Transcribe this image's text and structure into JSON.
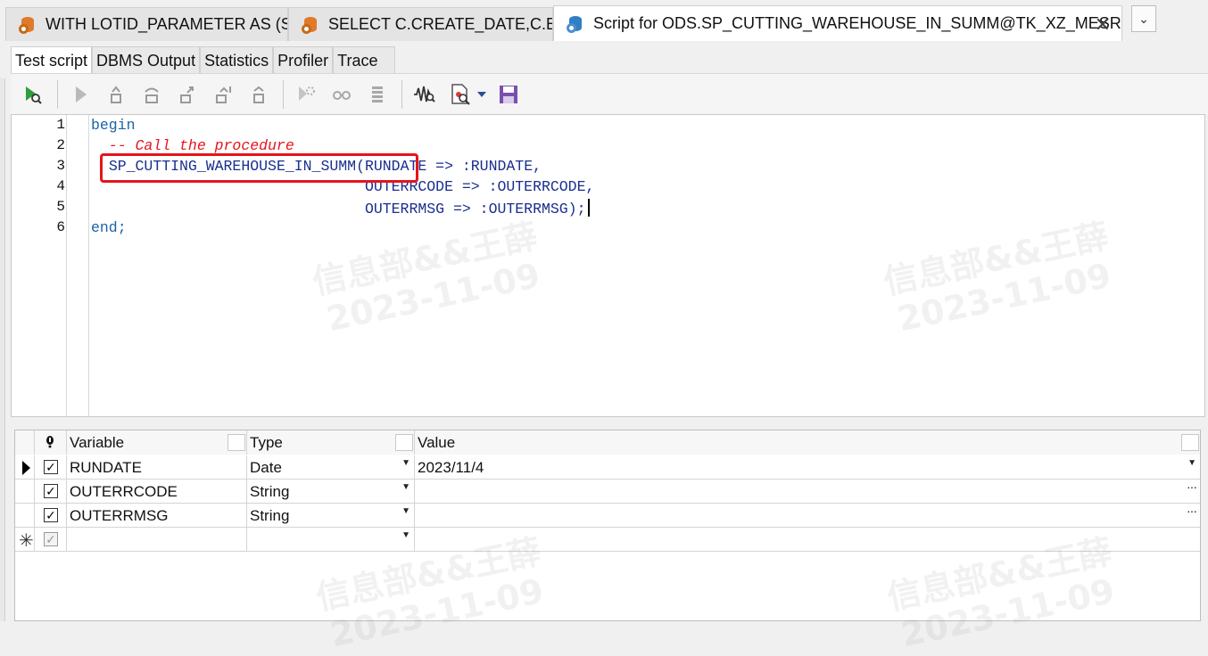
{
  "doc_tabs": [
    {
      "label": "WITH LOTID_PARAMETER AS (S ...",
      "active": false
    },
    {
      "label": "SELECT C.CREATE_DATE,C.BSF ...",
      "active": false
    },
    {
      "label": "Script for ODS.SP_CUTTING_WAREHOUSE_IN_SUMM@TK_XZ_MESRPT",
      "active": true
    }
  ],
  "tab_close_symbol": "✕",
  "tabs_dropdown_symbol": "⌄",
  "inner_tabs": [
    "Test script",
    "DBMS Output",
    "Statistics",
    "Profiler",
    "Trace"
  ],
  "toolbar_icons": [
    "start-debugger-icon",
    "run-icon",
    "step-into-icon",
    "step-over-icon",
    "step-out-icon",
    "run-to-next-exception-icon",
    "run-to-cursor-icon",
    "toggle-breakpoint-icon",
    "set-variable-icon",
    "call-stack-icon",
    "profiler-icon",
    "open-script-icon",
    "dropdown-icon",
    "save-icon"
  ],
  "editor": {
    "line_numbers": [
      "1",
      "2",
      "3",
      "4",
      "5",
      "6"
    ],
    "line1": "begin",
    "line2": "  -- Call the procedure",
    "line3_indent": "  ",
    "line3_proc": "SP_CUTTING_WAREHOUSE_IN_SUMM",
    "line3_rest": "(RUNDATE => :RUNDATE,",
    "line4": "                               OUTERRCODE => :OUTERRCODE,",
    "line5": "                               OUTERRMSG => :OUTERRMSG);",
    "line6": "end;"
  },
  "watermark": {
    "line1": "信息部&&王薛",
    "line2": "2023-11-09"
  },
  "grid": {
    "headers": {
      "variable": "Variable",
      "type": "Type",
      "value": "Value"
    },
    "rows": [
      {
        "variable": "RUNDATE",
        "type": "Date",
        "value": "2023/11/4",
        "checked": true
      },
      {
        "variable": "OUTERRCODE",
        "type": "String",
        "value": "",
        "checked": true
      },
      {
        "variable": "OUTERRMSG",
        "type": "String",
        "value": "",
        "checked": true
      }
    ],
    "ellipsis": "···",
    "new_row_symbol": "✳"
  },
  "colors": {
    "keyword": "#1a63a8",
    "comment": "#e8121c",
    "identifier": "#1a2f8f",
    "highlight_box": "#e5141b"
  }
}
